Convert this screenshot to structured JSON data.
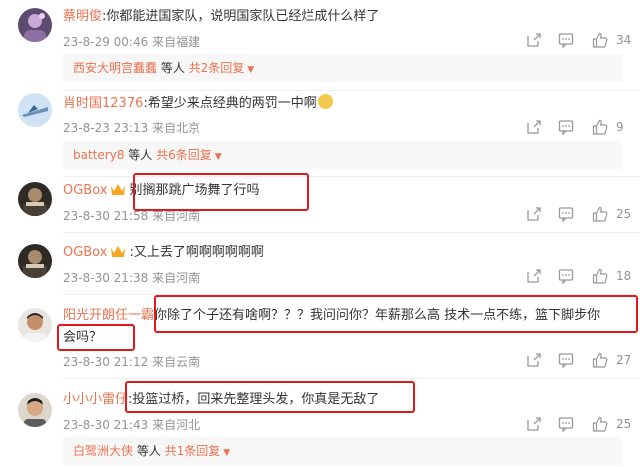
{
  "comments": [
    {
      "username": "蔡明俊",
      "text": ":你都能进国家队，说明国家队已经烂成什么样了",
      "time": "23-8-29 00:46",
      "location": "来自福建",
      "likes": "34",
      "reply": {
        "names": "西安大明宫蠢蠢",
        "mid": " 等人 ",
        "more": "共2条回复"
      }
    },
    {
      "username": "肖时国12376",
      "text": ":希望少来点经典的两罚一中啊",
      "time": "23-8-23 23:13",
      "location": "来自北京",
      "likes": "9",
      "reply": {
        "names": "battery8",
        "mid": " 等人 ",
        "more": "共6条回复"
      }
    },
    {
      "username": "OGBox",
      "text": "别搁那跳广场舞了行吗",
      "time": "23-8-30 21:58",
      "location": "来自河南",
      "likes": "25"
    },
    {
      "username": "OGBox",
      "text": ":又上丢了啊啊啊啊啊啊",
      "time": "23-8-30 21:38",
      "location": "来自河南",
      "likes": "18"
    },
    {
      "username": "阳光开朗任一霸",
      "text": "你除了个子还有啥啊？？？我问问你？年薪那么高 技术一点不练，篮下脚步你",
      "text2": "会吗？",
      "time": "23-8-30 21:12",
      "location": "来自云南",
      "likes": "27"
    },
    {
      "username": "小小小雷仔",
      "text": ":投篮过桥，回来先整理头发，你真是无敌了",
      "time": "23-8-30 21:43",
      "location": "来自河北",
      "likes": "25",
      "reply": {
        "names": "白鹭洲大侠",
        "mid": " 等人 ",
        "more": "共1条回复"
      }
    }
  ],
  "colors": {
    "username": "#eb7350",
    "meta": "#939393",
    "highlight": "#e0191f"
  },
  "icons": [
    "share-icon",
    "comment-icon",
    "like-icon",
    "chevron-down-icon",
    "emoji-icon",
    "vip-crown-icon"
  ]
}
